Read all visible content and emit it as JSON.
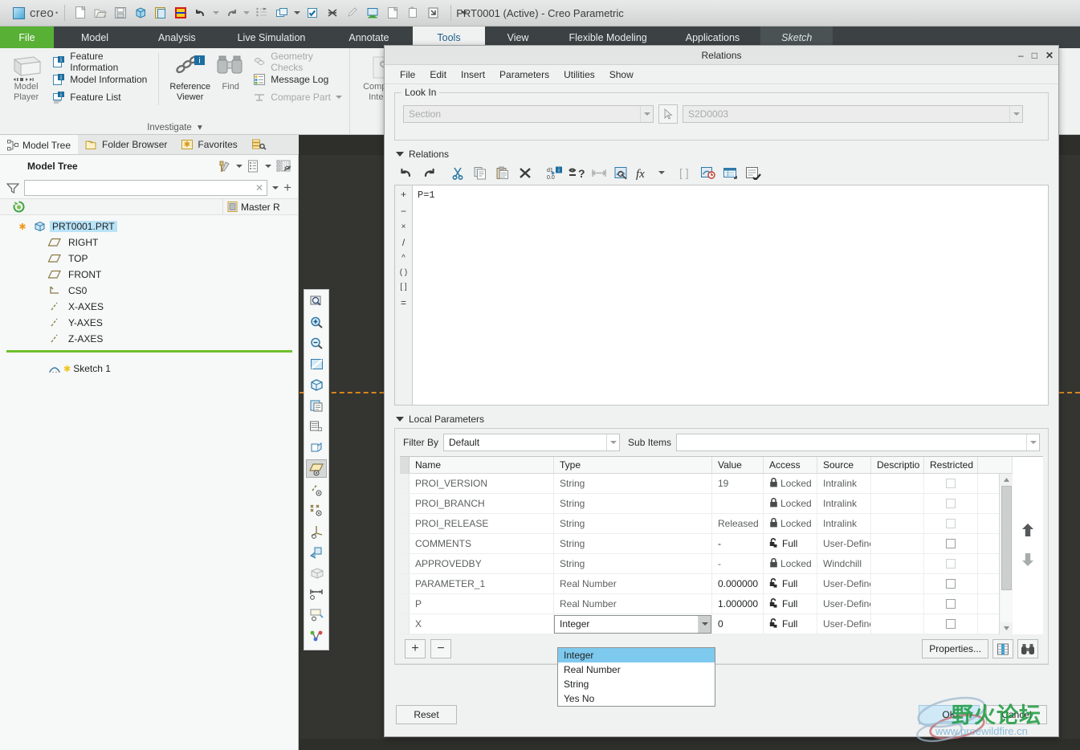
{
  "app": {
    "brand": "creo",
    "window_title": "PRT0001 (Active) - Creo Parametric",
    "quick_access": [
      {
        "name": "new-icon",
        "glyph": "⬜"
      },
      {
        "name": "open-icon",
        "glyph": "📂"
      },
      {
        "name": "save-icon",
        "glyph": "💾"
      },
      {
        "name": "regenerate-icon",
        "glyph": "▢"
      },
      {
        "name": "save-a-copy-icon",
        "glyph": "▣"
      },
      {
        "name": "window-colors-icon",
        "glyph": "▤"
      },
      {
        "name": "undo-icon",
        "glyph": "↶"
      },
      {
        "name": "redo-icon",
        "glyph": "↷"
      },
      {
        "name": "regenerate-model-icon",
        "glyph": "↺"
      },
      {
        "name": "window-switch-icon",
        "glyph": "❐"
      },
      {
        "name": "select-items-icon",
        "glyph": "☑"
      },
      {
        "name": "close-window-icon",
        "glyph": "⌧"
      },
      {
        "name": "annotate-icon",
        "glyph": "✎"
      },
      {
        "name": "publish-icon",
        "glyph": "🖥"
      },
      {
        "name": "new-window-icon",
        "glyph": "⬚"
      },
      {
        "name": "copy-window-icon",
        "glyph": "❐"
      },
      {
        "name": "detach-window-icon",
        "glyph": "⇲"
      }
    ]
  },
  "ribbon": {
    "tabs": [
      {
        "label": "File",
        "state": "file"
      },
      {
        "label": "Model",
        "state": "normal"
      },
      {
        "label": "Analysis",
        "state": "normal"
      },
      {
        "label": "Live Simulation",
        "state": "normal"
      },
      {
        "label": "Annotate",
        "state": "normal"
      },
      {
        "label": "Tools",
        "state": "active"
      },
      {
        "label": "View",
        "state": "normal"
      },
      {
        "label": "Flexible Modeling",
        "state": "normal"
      },
      {
        "label": "Applications",
        "state": "normal"
      },
      {
        "label": "Sketch",
        "state": "context"
      }
    ],
    "groups": [
      {
        "label": "Investigate",
        "big_buttons": [
          {
            "label_line1": "Model",
            "label_line2": "Player",
            "name": "model-player-button",
            "enabled": false
          }
        ],
        "items": [
          {
            "label": "Feature Information",
            "icon": "feature-information-icon",
            "enabled": true
          },
          {
            "label": "Model Information",
            "icon": "model-information-icon",
            "enabled": true
          },
          {
            "label": "Feature List",
            "icon": "feature-list-icon",
            "enabled": true
          }
        ],
        "big_buttons2": [
          {
            "label_line1": "Reference",
            "label_line2": "Viewer",
            "name": "reference-viewer-button",
            "enabled": true
          },
          {
            "label_line1": "Find",
            "label_line2": "",
            "name": "find-button",
            "enabled": false
          }
        ],
        "items2": [
          {
            "label": "Geometry Checks",
            "icon": "geometry-checks-icon",
            "enabled": false
          },
          {
            "label": "Message Log",
            "icon": "message-log-icon",
            "enabled": true
          },
          {
            "label": "Compare Part",
            "icon": "compare-part-icon",
            "enabled": false,
            "has_caret": true
          }
        ]
      },
      {
        "label": "",
        "big_buttons": [
          {
            "label_line1": "Component",
            "label_line2": "Interface",
            "name": "component-interface-button",
            "enabled": false
          }
        ]
      }
    ]
  },
  "navigator": {
    "tabs": [
      {
        "label": "Model Tree",
        "icon": "model-tree-icon",
        "active": true
      },
      {
        "label": "Folder Browser",
        "icon": "folder-browser-icon",
        "active": false
      },
      {
        "label": "Favorites",
        "icon": "favorites-icon",
        "active": false
      },
      {
        "label": "",
        "icon": "search-layers-icon",
        "active": false
      }
    ],
    "panel_title": "Model Tree",
    "head_icons": [
      {
        "name": "settings-tools-icon"
      },
      {
        "name": "tree-columns-icon"
      },
      {
        "name": "tree-filters-icon"
      }
    ],
    "filter": {
      "value": "",
      "placeholder": "",
      "icon": "filter-icon",
      "clear_icon": "clear-x-icon",
      "add_icon": "add-plus-icon"
    },
    "columns": [
      {
        "label": "",
        "icon": "refresh-tree-icon"
      },
      {
        "label": "Master R",
        "icon": "master-rep-icon"
      }
    ],
    "rows": [
      {
        "label": "PRT0001.PRT",
        "icon": "part-icon",
        "indent": 0,
        "selected": true,
        "prefix_icon": "asterisk-icon"
      },
      {
        "label": "RIGHT",
        "icon": "datum-plane-icon",
        "indent": 1,
        "selected": false
      },
      {
        "label": "TOP",
        "icon": "datum-plane-icon",
        "indent": 1,
        "selected": false
      },
      {
        "label": "FRONT",
        "icon": "datum-plane-icon",
        "indent": 1,
        "selected": false
      },
      {
        "label": "CS0",
        "icon": "coordinate-system-icon",
        "indent": 1,
        "selected": false
      },
      {
        "label": "X-AXES",
        "icon": "axis-icon",
        "indent": 1,
        "selected": false
      },
      {
        "label": "Y-AXES",
        "icon": "axis-icon",
        "indent": 1,
        "selected": false
      },
      {
        "label": "Z-AXES",
        "icon": "axis-icon",
        "indent": 1,
        "selected": false
      },
      {
        "label": "Sketch 1",
        "icon": "sketch-icon",
        "indent": 1,
        "selected": false,
        "after_divider": true,
        "prefix_icon": "asterisk-icon"
      }
    ]
  },
  "graphics_toolbar": [
    {
      "name": "refit-zoom-icon"
    },
    {
      "name": "zoom-in-icon"
    },
    {
      "name": "zoom-out-icon"
    },
    {
      "name": "repaint-icon"
    },
    {
      "name": "display-style-icon"
    },
    {
      "name": "saved-orientations-icon"
    },
    {
      "name": "view-manager-icon"
    },
    {
      "name": "named-view-icon"
    },
    {
      "name": "datum-plane-display-icon"
    },
    {
      "name": "axis-display-icon"
    },
    {
      "name": "point-display-icon"
    },
    {
      "name": "csys-display-icon"
    },
    {
      "name": "spin-center-icon"
    },
    {
      "name": "perspective-view-icon"
    },
    {
      "name": "annotation-display-icon"
    },
    {
      "name": "note-display-icon"
    },
    {
      "name": "network-display-icon"
    }
  ],
  "dialog": {
    "title": "Relations",
    "window_buttons": [
      {
        "name": "minimize-button",
        "glyph": "–"
      },
      {
        "name": "maximize-button",
        "glyph": "□"
      },
      {
        "name": "close-button",
        "glyph": "✕"
      }
    ],
    "menu": [
      "File",
      "Edit",
      "Insert",
      "Parameters",
      "Utilities",
      "Show"
    ],
    "look_in": {
      "legend": "Look In",
      "type_value": "Section",
      "object_value": "S2D0003",
      "picker_icon": "select-arrow-icon"
    },
    "relations": {
      "header": "Relations",
      "toolbar": [
        {
          "name": "undo-icon",
          "disabled": false
        },
        {
          "name": "redo-icon",
          "disabled": false
        },
        {
          "name": "cut-icon",
          "disabled": false
        },
        {
          "name": "copy-icon",
          "disabled": false
        },
        {
          "name": "paste-icon",
          "disabled": false
        },
        {
          "name": "delete-icon",
          "disabled": false
        },
        {
          "name": "dimension-info-icon",
          "disabled": false
        },
        {
          "name": "verify-relations-icon",
          "disabled": false
        },
        {
          "name": "switch-dimensions-icon",
          "disabled": true
        },
        {
          "name": "show-dimensions-icon",
          "disabled": false
        },
        {
          "name": "insert-function-icon",
          "disabled": false
        },
        {
          "name": "brackets-icon",
          "disabled": true
        },
        {
          "name": "relation-history-icon",
          "disabled": false
        },
        {
          "name": "parameters-table-icon",
          "disabled": false
        },
        {
          "name": "edit-notes-icon",
          "disabled": false
        }
      ],
      "operators": [
        "+",
        "−",
        "×",
        "/",
        "^",
        "( )",
        "[ ]",
        "="
      ],
      "text": "P=1"
    },
    "local_parameters": {
      "header": "Local Parameters",
      "filter_by_label": "Filter By",
      "filter_by_value": "Default",
      "sub_items_label": "Sub Items",
      "sub_items_value": "",
      "columns": [
        "Name",
        "Type",
        "Value",
        "Access",
        "Source",
        "Descriptio",
        "Restricted"
      ],
      "rows": [
        {
          "name": "PROI_VERSION",
          "type": "String",
          "value": "19",
          "access": "Locked",
          "access_state": "locked",
          "source": "Intralink",
          "description": "",
          "restricted": false,
          "restricted_enabled": false
        },
        {
          "name": "PROI_BRANCH",
          "type": "String",
          "value": "",
          "access": "Locked",
          "access_state": "locked",
          "source": "Intralink",
          "description": "",
          "restricted": false,
          "restricted_enabled": false
        },
        {
          "name": "PROI_RELEASE",
          "type": "String",
          "value": "Released",
          "access": "Locked",
          "access_state": "locked",
          "source": "Intralink",
          "description": "",
          "restricted": false,
          "restricted_enabled": false
        },
        {
          "name": "COMMENTS",
          "type": "String",
          "value": "-",
          "access": "Full",
          "access_state": "full",
          "source": "User-Define",
          "description": "",
          "restricted": false,
          "restricted_enabled": true
        },
        {
          "name": "APPROVEDBY",
          "type": "String",
          "value": "-",
          "access": "Locked",
          "access_state": "locked",
          "source": "Windchill",
          "description": "",
          "restricted": false,
          "restricted_enabled": false
        },
        {
          "name": "PARAMETER_1",
          "type": "Real Number",
          "value": "0.000000",
          "access": "Full",
          "access_state": "full",
          "source": "User-Define",
          "description": "",
          "restricted": false,
          "restricted_enabled": true
        },
        {
          "name": "P",
          "type": "Real Number",
          "value": "1.000000",
          "access": "Full",
          "access_state": "full",
          "source": "User-Define",
          "description": "",
          "restricted": false,
          "restricted_enabled": true
        },
        {
          "name": "X",
          "type": "Integer",
          "value": "0",
          "access": "Full",
          "access_state": "full",
          "source": "User-Define",
          "description": "",
          "restricted": false,
          "restricted_enabled": true,
          "editing_type": true
        }
      ],
      "type_options": [
        "Integer",
        "Real Number",
        "String",
        "Yes No"
      ],
      "type_selected": "Integer",
      "add_button": "+",
      "remove_button": "−",
      "properties_button": "Properties...",
      "columns_button_icon": "table-columns-icon",
      "find_button_icon": "binoculars-icon",
      "move_up_icon": "move-up-arrow-icon",
      "move_down_icon": "move-down-arrow-icon"
    },
    "footer": {
      "reset": "Reset",
      "ok": "OK",
      "cancel": "Cancel"
    }
  },
  "watermark": {
    "chinese": "野火论坛",
    "url": "www.proewildfire.cn"
  },
  "colors": {
    "file_tab_green": "#58b035",
    "ribbon_dark": "#3c4243",
    "active_tab_text": "#1d5e8a",
    "tree_divider_green": "#6fc02c",
    "selection_blue": "#b9e3f7",
    "dropdown_highlight": "#7ec9ee",
    "graphics_bg": "#343430",
    "dashed_line_orange": "#e08a1e"
  }
}
